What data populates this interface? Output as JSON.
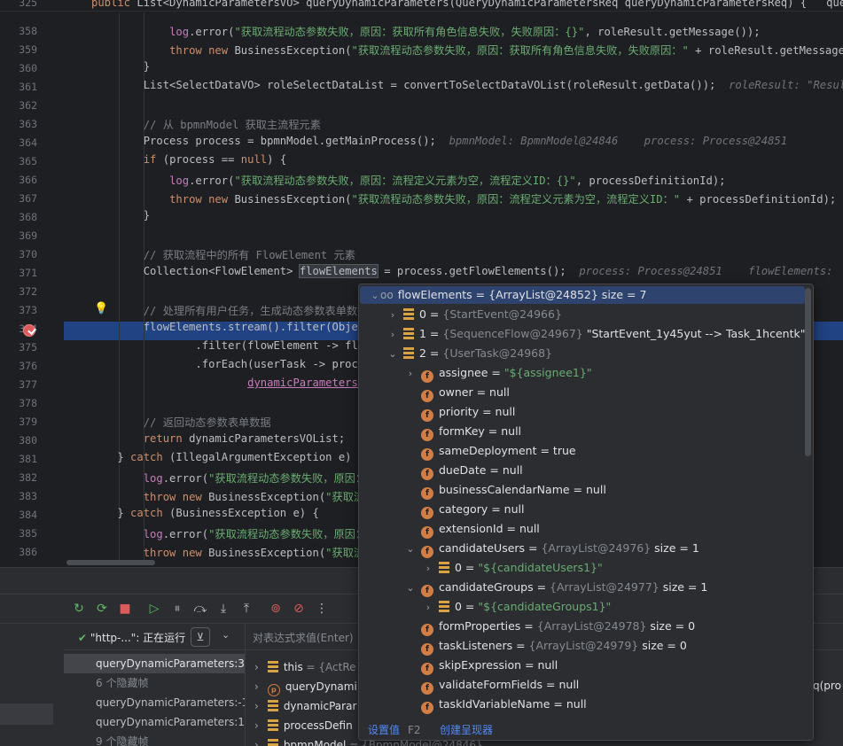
{
  "editor": {
    "sticky_header": "public List<DynamicParametersVO> queryDynamicParameters(QueryDynamicParametersReq queryDynamicParametersReq) {   queryDynam",
    "sticky_line_number": "325",
    "lines": [
      {
        "n": "358",
        "html": "            <span class=\"ivar\">log</span>.error(<span class=\"str\">\"获取流程动态参数失败，原因：获取所有角色信息失败，失败原因：{}\"</span>, roleResult.getMessage());"
      },
      {
        "n": "359",
        "html": "            <span class=\"kw\">throw new</span> BusinessException(<span class=\"str\">\"获取流程动态参数失败，原因：获取所有角色信息失败，失败原因：\"</span> + roleResult.getMessage());"
      },
      {
        "n": "360",
        "html": "        }"
      },
      {
        "n": "361",
        "html": "        List&lt;SelectDataVO&gt; roleSelectDataList = convertToSelectDataVOList(roleResult.getData());  <span class=\"hint\">roleResult: \"Result(cod</span>"
      },
      {
        "n": "362",
        "html": ""
      },
      {
        "n": "363",
        "html": "        <span class=\"cmt\">// 从 bpmnModel 获取主流程元素</span>"
      },
      {
        "n": "364",
        "html": "        Process process = bpmnModel.getMainProcess();  <span class=\"hint\">bpmnModel: BpmnModel@24846    process: Process@24851</span>"
      },
      {
        "n": "365",
        "html": "        <span class=\"kw\">if</span> (process == <span class=\"kw\">null</span>) {"
      },
      {
        "n": "366",
        "html": "            <span class=\"ivar\">log</span>.error(<span class=\"str\">\"获取流程动态参数失败，原因：流程定义元素为空，流程定义ID：{}\"</span>, processDefinitionId);"
      },
      {
        "n": "367",
        "html": "            <span class=\"kw\">throw new</span> BusinessException(<span class=\"str\">\"获取流程动态参数失败，原因：流程定义元素为空，流程定义ID：\"</span> + processDefinitionId);  <span class=\"hint\">pro</span>"
      },
      {
        "n": "368",
        "html": "        }"
      },
      {
        "n": "369",
        "html": ""
      },
      {
        "n": "370",
        "html": "        <span class=\"cmt\">// 获取流程中的所有 FlowElement 元素</span>"
      },
      {
        "n": "371",
        "html": "        Collection&lt;FlowElement&gt; <span class=\"hilite\">flowElements</span> = process.getFlowElements();  <span class=\"hint\">process: Process@24851    flowElements:  size</span>"
      },
      {
        "n": "372",
        "html": ""
      },
      {
        "n": "373",
        "html": "        <span class=\"cmt\">// 处理所有用户任务，生成动态参数表单数据</span>"
      },
      {
        "n": "374",
        "html": "        flowElements.stream().filter(Object"
      },
      {
        "n": "375",
        "html": "                .filter(flowElement -&gt; flow"
      },
      {
        "n": "376",
        "html": "                .forEach(userTask -&gt; proces"
      },
      {
        "n": "377",
        "html": "                        <span class=\"ivar ul\">dynamicParametersVO</span>"
      },
      {
        "n": "378",
        "html": ""
      },
      {
        "n": "379",
        "html": "        <span class=\"cmt\">// 返回动态参数表单数据</span>"
      },
      {
        "n": "380",
        "html": "        <span class=\"kw\">return</span> dynamicParametersVOList;"
      },
      {
        "n": "381",
        "html": "    } <span class=\"kw\">catch</span> (IllegalArgumentException e) {"
      },
      {
        "n": "382",
        "html": "        <span class=\"ivar\">log</span>.error(<span class=\"str\">\"获取流程动态参数失败，原因：</span>"
      },
      {
        "n": "383",
        "html": "        <span class=\"kw\">throw new</span> BusinessException(<span class=\"str\">\"获取流程</span>"
      },
      {
        "n": "384",
        "html": "    } <span class=\"kw\">catch</span> (BusinessException e) {"
      },
      {
        "n": "385",
        "html": "        <span class=\"ivar\">log</span>.error(<span class=\"str\">\"获取流程动态参数失败，原因：</span>"
      },
      {
        "n": "386",
        "html": "        <span class=\"kw\">throw new</span> BusinessException(<span class=\"str\">\"获取流程</span>"
      }
    ]
  },
  "popup": {
    "root": {
      "name": "flowElements",
      "eq": " = ",
      "type": "{ArrayList@24852}",
      "extra": "  size = 7"
    },
    "nodes": [
      {
        "indent": 1,
        "chev": "right",
        "icon": "arr",
        "name": "0",
        "type": "{StartEvent@24966}",
        "val": ""
      },
      {
        "indent": 1,
        "chev": "right",
        "icon": "arr",
        "name": "1",
        "type": "{SequenceFlow@24967}",
        "val": " \"StartEvent_1y45yut --> Task_1hcentk\""
      },
      {
        "indent": 1,
        "chev": "down",
        "icon": "arr",
        "name": "2",
        "type": "{UserTask@24968}",
        "val": ""
      },
      {
        "indent": 2,
        "chev": "right",
        "icon": "f",
        "name": "assignee",
        "type": "",
        "val": "",
        "str": "\"${assignee1}\""
      },
      {
        "indent": 2,
        "chev": "",
        "icon": "f",
        "name": "owner",
        "type": "",
        "val": "null"
      },
      {
        "indent": 2,
        "chev": "",
        "icon": "f",
        "name": "priority",
        "type": "",
        "val": "null"
      },
      {
        "indent": 2,
        "chev": "",
        "icon": "f",
        "name": "formKey",
        "type": "",
        "val": "null"
      },
      {
        "indent": 2,
        "chev": "",
        "icon": "f",
        "name": "sameDeployment",
        "type": "",
        "val": "true"
      },
      {
        "indent": 2,
        "chev": "",
        "icon": "f",
        "name": "dueDate",
        "type": "",
        "val": "null"
      },
      {
        "indent": 2,
        "chev": "",
        "icon": "f",
        "name": "businessCalendarName",
        "type": "",
        "val": "null"
      },
      {
        "indent": 2,
        "chev": "",
        "icon": "f",
        "name": "category",
        "type": "",
        "val": "null"
      },
      {
        "indent": 2,
        "chev": "",
        "icon": "f",
        "name": "extensionId",
        "type": "",
        "val": "null"
      },
      {
        "indent": 2,
        "chev": "down",
        "icon": "f",
        "name": "candidateUsers",
        "type": "{ArrayList@24976}",
        "val": "  size = 1"
      },
      {
        "indent": 3,
        "chev": "right",
        "icon": "arr",
        "name": "0",
        "type": "",
        "val": "",
        "str": "\"${candidateUsers1}\""
      },
      {
        "indent": 2,
        "chev": "down",
        "icon": "f",
        "name": "candidateGroups",
        "type": "{ArrayList@24977}",
        "val": "  size = 1"
      },
      {
        "indent": 3,
        "chev": "right",
        "icon": "arr",
        "name": "0",
        "type": "",
        "val": "",
        "str": "\"${candidateGroups1}\""
      },
      {
        "indent": 2,
        "chev": "",
        "icon": "f",
        "name": "formProperties",
        "type": "{ArrayList@24978}",
        "val": "  size = 0"
      },
      {
        "indent": 2,
        "chev": "",
        "icon": "f",
        "name": "taskListeners",
        "type": "{ArrayList@24979}",
        "val": "  size = 0"
      },
      {
        "indent": 2,
        "chev": "",
        "icon": "f",
        "name": "skipExpression",
        "type": "",
        "val": "null"
      },
      {
        "indent": 2,
        "chev": "",
        "icon": "f",
        "name": "validateFormFields",
        "type": "",
        "val": "null"
      },
      {
        "indent": 2,
        "chev": "",
        "icon": "f",
        "name": "taskIdVariableName",
        "type": "",
        "val": "null"
      }
    ],
    "footer": {
      "set_value": "设置值",
      "set_value_key": "F2",
      "create_renderer": "创建呈现器"
    }
  },
  "debug": {
    "thread_label": "\"http-...\": 正在运行",
    "eval_placeholder": "对表达式求值(Enter)",
    "frames": [
      {
        "text": "queryDynamicParameters:374",
        "kind": "sel"
      },
      {
        "text": "6 个隐藏帧",
        "kind": "hidden"
      },
      {
        "text": "queryDynamicParameters:-1,",
        "kind": "normal"
      },
      {
        "text": "queryDynamicParameters:18",
        "kind": "normal"
      },
      {
        "text": "9 个隐藏帧",
        "kind": "hidden"
      }
    ],
    "vars": [
      {
        "icon": "arr",
        "name": "this",
        "val": " = {ActRe"
      },
      {
        "icon": "p",
        "name": "queryDynami",
        "val": ""
      },
      {
        "icon": "arr",
        "name": "dynamicParar",
        "val": ""
      },
      {
        "icon": "arr",
        "name": "processDefin",
        "val": ""
      },
      {
        "icon": "arr",
        "name": "bpmnModel",
        "val": " = {BpmnModel@24846}"
      }
    ],
    "right_fragment": "q(pro"
  }
}
